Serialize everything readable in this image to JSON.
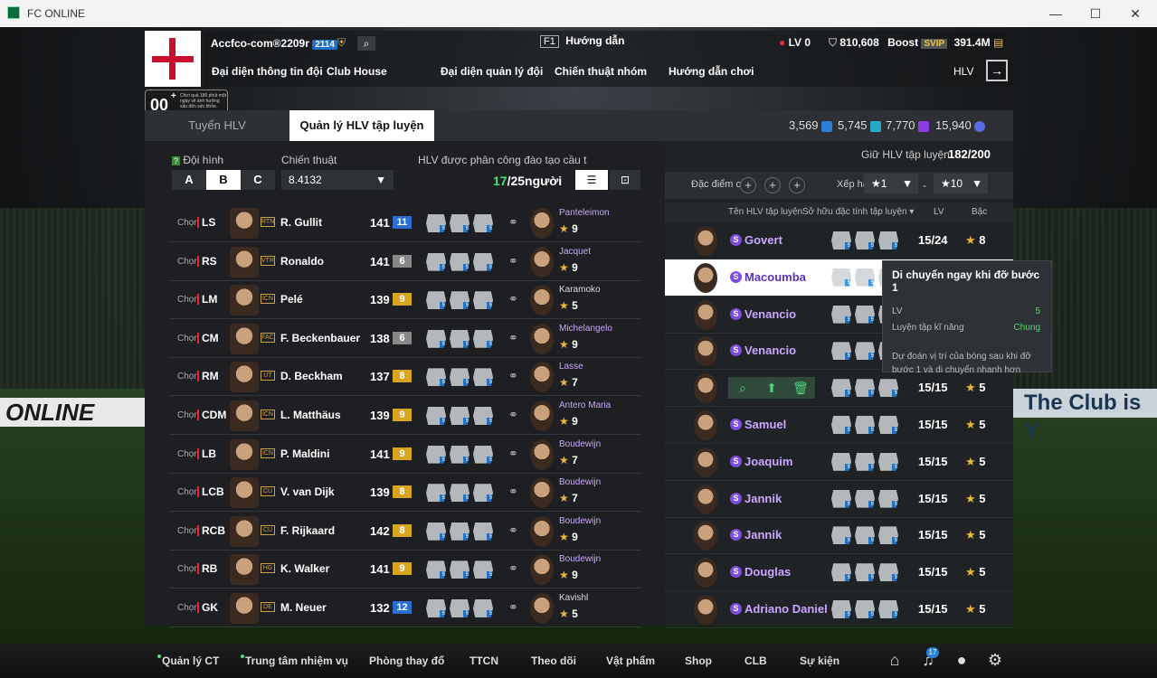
{
  "window": {
    "title": "FC ONLINE"
  },
  "header": {
    "account": "Accfco-com®2209r",
    "account_badge": "2114",
    "guide_key": "F1",
    "guide": "Hướng dẫn",
    "lv": "LV 0",
    "coins": "810,608",
    "boost": "Boost",
    "svip": "SVIP",
    "bp": "391.4M",
    "hlv": "HLV"
  },
  "ovr_box": {
    "value": "00",
    "note": "Chơi quá 180 phút một ngày sẽ ảnh hưởng xấu đến sức khỏe."
  },
  "nav": [
    "Đại diện thông tin đội",
    "Club House",
    "Đại diện quản lý đội",
    "Chiến thuật nhóm",
    "Hướng dẫn chơi"
  ],
  "tabs": [
    "Tuyển HLV",
    "Quản lý HLV tập luyện"
  ],
  "currencies": [
    "3,569",
    "5,745",
    "7,770",
    "15,940"
  ],
  "left": {
    "squad_label": "Đội hình",
    "squads": [
      "A",
      "B",
      "C"
    ],
    "tactic_label": "Chiến thuật",
    "tactic": "8.4132",
    "assigned_label": "HLV được phân công đào tạo cầu t",
    "assigned": "17",
    "assigned_total": "/25người"
  },
  "players": [
    {
      "chon": "Chọn",
      "pos": "LS",
      "season": "RTN",
      "name": "R. Gullit",
      "ovr": "141",
      "lv": "11",
      "coach": "Panteleimon",
      "stars": "9",
      "cw": false,
      "lvc": "#2a6fd0"
    },
    {
      "chon": "Chọn",
      "pos": "RS",
      "season": "VTR",
      "name": "Ronaldo",
      "ovr": "141",
      "lv": "6",
      "coach": "Jacquet",
      "stars": "9",
      "cw": false,
      "lvc": "#888"
    },
    {
      "chon": "Chọn",
      "pos": "LM",
      "season": "ICN",
      "name": "Pelé",
      "ovr": "139",
      "lv": "9",
      "coach": "Karamoko",
      "stars": "5",
      "cw": true,
      "lvc": "#d8a520"
    },
    {
      "chon": "Chọn",
      "pos": "CM",
      "season": "FAC",
      "name": "F. Beckenbauer",
      "ovr": "138",
      "lv": "6",
      "coach": "Michelangelo",
      "stars": "9",
      "cw": false,
      "lvc": "#888"
    },
    {
      "chon": "Chọn",
      "pos": "RM",
      "season": "UT",
      "name": "D. Beckham",
      "ovr": "137",
      "lv": "8",
      "coach": "Lasse",
      "stars": "7",
      "cw": false,
      "lvc": "#d8a520"
    },
    {
      "chon": "Chọn",
      "pos": "CDM",
      "season": "ICN",
      "name": "L. Matthäus",
      "ovr": "139",
      "lv": "9",
      "coach": "Antero Maria",
      "stars": "9",
      "cw": false,
      "lvc": "#d8a520"
    },
    {
      "chon": "Chọn",
      "pos": "LB",
      "season": "ICN",
      "name": "P. Maldini",
      "ovr": "141",
      "lv": "9",
      "coach": "Boudewijn",
      "stars": "7",
      "cw": false,
      "lvc": "#d8a520"
    },
    {
      "chon": "Chọn",
      "pos": "LCB",
      "season": "CU",
      "name": "V. van Dijk",
      "ovr": "139",
      "lv": "8",
      "coach": "Boudewijn",
      "stars": "7",
      "cw": false,
      "lvc": "#d8a520"
    },
    {
      "chon": "Chọn",
      "pos": "RCB",
      "season": "CU",
      "name": "F. Rijkaard",
      "ovr": "142",
      "lv": "8",
      "coach": "Boudewijn",
      "stars": "9",
      "cw": false,
      "lvc": "#d8a520"
    },
    {
      "chon": "Chọn",
      "pos": "RB",
      "season": "HG",
      "name": "K. Walker",
      "ovr": "141",
      "lv": "9",
      "coach": "Boudewijn",
      "stars": "9",
      "cw": false,
      "lvc": "#d8a520"
    },
    {
      "chon": "Chọn",
      "pos": "GK",
      "season": "DE",
      "name": "M. Neuer",
      "ovr": "132",
      "lv": "12",
      "coach": "Kavishl",
      "stars": "5",
      "cw": true,
      "lvc": "#2a6fd0"
    }
  ],
  "right": {
    "hold_label": "Giữ HLV tập luyện",
    "hold": "182/200",
    "filter_label": "Đặc điểm c",
    "rank_label": "Xếp hạ",
    "from": "★1",
    "dash": "-",
    "to": "★10",
    "cols": [
      "Tên HLV tập luyện",
      "Sở hữu đặc tính tập luyện ▾",
      "LV",
      "Bậc"
    ]
  },
  "coaches": [
    {
      "name": "Govert",
      "lv": "15/24",
      "rank": "8"
    },
    {
      "name": "Macoumba",
      "lv": "",
      "rank": ""
    },
    {
      "name": "Venancio",
      "lv": "",
      "rank": ""
    },
    {
      "name": "Venancio",
      "lv": "",
      "rank": ""
    },
    {
      "name": "",
      "lv": "15/15",
      "rank": "5"
    },
    {
      "name": "Samuel",
      "lv": "15/15",
      "rank": "5"
    },
    {
      "name": "Joaquim",
      "lv": "15/15",
      "rank": "5"
    },
    {
      "name": "Jannik",
      "lv": "15/15",
      "rank": "5"
    },
    {
      "name": "Jannik",
      "lv": "15/15",
      "rank": "5"
    },
    {
      "name": "Douglas",
      "lv": "15/15",
      "rank": "5"
    },
    {
      "name": "Adriano Daniel",
      "lv": "15/15",
      "rank": "5"
    }
  ],
  "tooltip": {
    "title": "Di chuyển ngay khi đỡ bước 1",
    "lv_label": "LV",
    "lv": "5",
    "skill_label": "Luyện tập kĩ năng",
    "skill": "Chung",
    "desc": "Dự đoán vị trí của bóng sau khi đỡ bước 1 và di chuyển nhanh hơn"
  },
  "bottom": {
    "items": [
      "Quản lý CT",
      "Trung tâm nhiệm vụ",
      "Phòng thay đổ",
      "TTCN",
      "Theo dõi",
      "Vật phẩm",
      "Shop",
      "CLB",
      "Sự kiện"
    ],
    "notif": "17"
  },
  "ads": {
    "left": "ONLINE",
    "right": "The Club is Y"
  }
}
